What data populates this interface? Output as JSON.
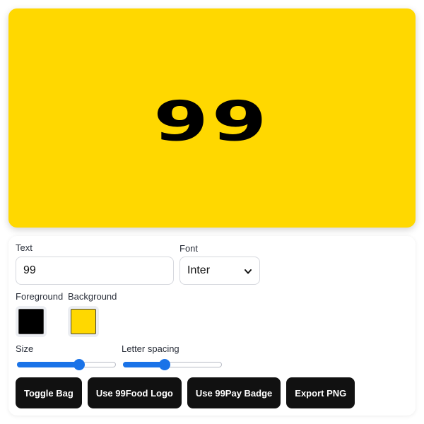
{
  "preview": {
    "text": "99",
    "foreground": "#000000",
    "background": "#FFD800"
  },
  "controls": {
    "text_label": "Text",
    "text_value": "99",
    "font_label": "Font",
    "font_value": "Inter",
    "foreground_label": "Foreground",
    "background_label": "Background",
    "foreground_color": "#000000",
    "background_color": "#FFD800",
    "size_label": "Size",
    "size_level": 0.63,
    "spacing_label": "Letter spacing",
    "spacing_level": 0.42
  },
  "buttons": {
    "toggle_bag": "Toggle Bag",
    "use_food_logo": "Use 99Food Logo",
    "use_pay_badge": "Use 99Pay Badge",
    "export_png": "Export PNG"
  },
  "icons": {
    "select_arrow": "chevron-down-icon"
  }
}
